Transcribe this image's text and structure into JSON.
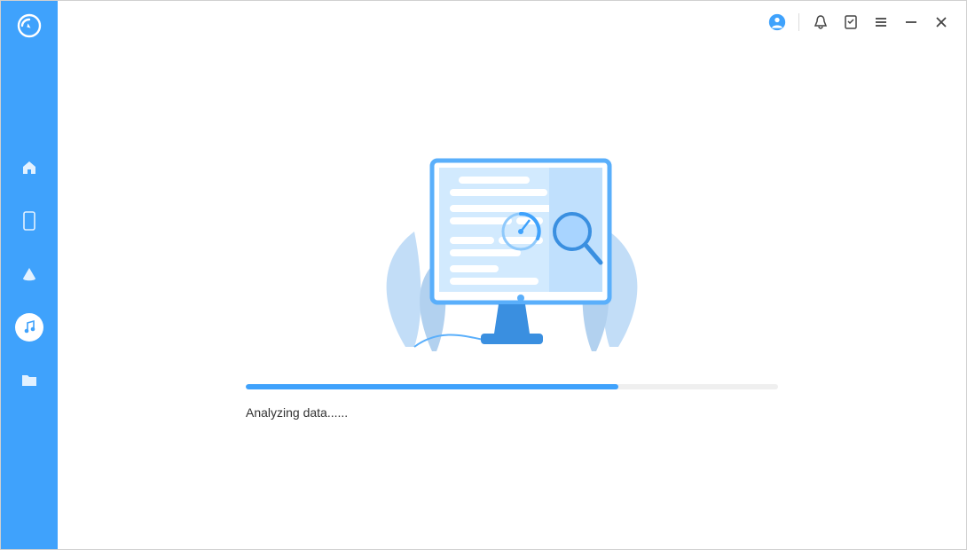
{
  "colors": {
    "accent": "#3fa2fc",
    "accentDark": "#3a8fe0",
    "accentLight": "#a8d4ff",
    "pale": "#d7eaff",
    "icon": "#444"
  },
  "sidebar": {
    "items": [
      {
        "name": "home",
        "active": false
      },
      {
        "name": "device",
        "active": false
      },
      {
        "name": "cloud",
        "active": false
      },
      {
        "name": "itunes",
        "active": true
      },
      {
        "name": "folder",
        "active": false
      }
    ]
  },
  "topbar": {
    "items": [
      {
        "name": "account"
      },
      {
        "name": "notification"
      },
      {
        "name": "feedback"
      },
      {
        "name": "menu"
      },
      {
        "name": "minimize"
      },
      {
        "name": "close"
      }
    ]
  },
  "progress": {
    "percent": 70,
    "status_text": "Analyzing data......"
  }
}
